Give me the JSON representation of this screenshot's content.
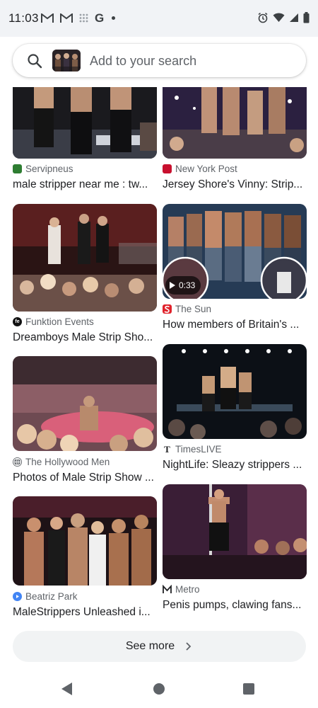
{
  "status_bar": {
    "time": "11:03",
    "left_icons": [
      "gmail-icon",
      "gmail-icon",
      "grid-dots-icon",
      "google-g-icon",
      "dot-icon"
    ],
    "right_icons": [
      "alarm-icon",
      "wifi-icon",
      "signal-icon",
      "battery-icon"
    ],
    "g_label": "G"
  },
  "search": {
    "placeholder": "Add to your search"
  },
  "results": {
    "col1": [
      {
        "source": "Servipneus",
        "title": "male stripper near me : tw..."
      },
      {
        "source": "Funktion Events",
        "title": "Dreamboys Male Strip Sho..."
      },
      {
        "source": "The Hollywood Men",
        "title": "Photos of Male Strip Show ..."
      },
      {
        "source": "Beatriz Park",
        "title": "MaleStrippers Unleashed i..."
      }
    ],
    "col2": [
      {
        "source": "New York Post",
        "title": "Jersey Shore's Vinny: Strip..."
      },
      {
        "source": "The Sun",
        "title": "How members of Britain's ...",
        "video_duration": "0:33"
      },
      {
        "source": "TimesLIVE",
        "title": "NightLife: Sleazy strippers ..."
      },
      {
        "source": "Metro",
        "title": "Penis pumps, clawing fans..."
      }
    ]
  },
  "see_more": {
    "label": "See more"
  },
  "colors": {
    "status_bg": "#f1f3f6",
    "text": "#202124",
    "secondary_text": "#5f6368",
    "see_more_bg": "#f1f3f4",
    "the_sun_red": "#e0222b",
    "ny_post_red": "#c8102e"
  }
}
